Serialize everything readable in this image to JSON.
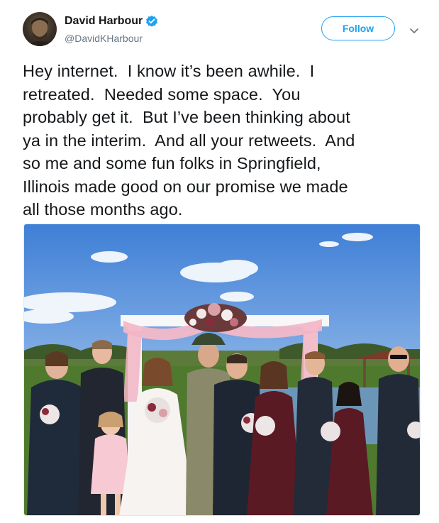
{
  "tweet": {
    "display_name": "David Harbour",
    "handle": "@DavidKHarbour",
    "verified": true,
    "follow_label": "Follow",
    "text": "Hey internet.  I know it’s been awhile.  I\nretreated.  Needed some space.  You\nprobably get it.  But I’ve been thinking about\nya in the interim.  And all your retweets.  And\nso me and some fun folks in Springfield,\nIllinois made good on our promise we made\nall those months ago."
  },
  "icons": {
    "verified": "verified-badge-icon",
    "more": "chevron-down-icon"
  },
  "colors": {
    "brand_blue": "#1da1f2",
    "text_primary": "#14171a",
    "text_secondary": "#657786"
  }
}
